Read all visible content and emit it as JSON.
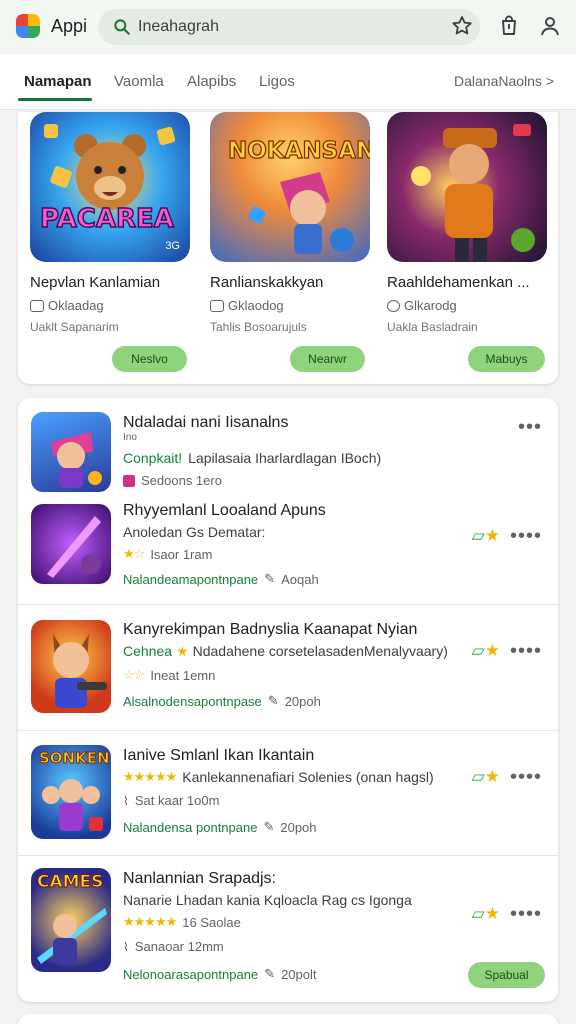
{
  "app": {
    "title": "Appi"
  },
  "search": {
    "text": "Ineahagrah"
  },
  "tabs": {
    "items": [
      "Namapan",
      "Vaomla",
      "Alapibs",
      "Ligos"
    ],
    "more": "DalanaNaolns >"
  },
  "featured": [
    {
      "art": "PACAREA",
      "badge": "3G",
      "title": "Nepvlan Kanlamian",
      "meta": "Oklaadag",
      "sub": "Uaklt Sapanarim",
      "button": "Neslvo"
    },
    {
      "art": "NOKANSAN",
      "badge": "",
      "title": "Ranlianskakkyan",
      "meta": "Gklaodog",
      "sub": "Tahlis Bosoarujuls",
      "button": "Nearwr"
    },
    {
      "art": "",
      "badge": "",
      "title": "Raahldehamenkan ...",
      "meta": "Glkarodg",
      "sub": "Uakla Basladrain",
      "button": "Mabuys"
    }
  ],
  "list": {
    "header": {
      "title": "Ndaladai nani Iisanalns",
      "subtitle": "Ino",
      "highlight": "Conpkait!",
      "desc": "Lapilasaia Iharlardlagan IBoch)",
      "meta": "Sedoons 1ero"
    },
    "rows": [
      {
        "title": "Rhyyemlanl Looaland Apuns",
        "line": "Anoledan Gs Dematar:",
        "rating_text": "Isaor 1ram",
        "green": "Nalandeamapontnpane",
        "tag": "Aoqah"
      },
      {
        "title": "Kanyrekimpan Badnyslia Kaanapat Nyian",
        "highlight": "Cehnea",
        "line": "Ndadahene corsetelasadenMenalyvaary)",
        "rating_text": "Ineat 1emn",
        "green": "Alsalnodensapontnpase",
        "tag": "20poh"
      },
      {
        "title": "Ianive Smlanl Ikan Ikantain",
        "line": "Kanlekannenafiari Solenies (onan hagsl)",
        "rating_text": "Sat kaar 1o0m",
        "green": "Nalandensa pontnpane",
        "tag": "20poh",
        "art": "SONKEN"
      },
      {
        "title": "Nanlannian Srapadjs:",
        "line": "Nanarie Lhadan kania Kqloacla Rag cs Igonga",
        "rating_text": "16 Saolae",
        "rating_text2": "Sanaoar 12mm",
        "green": "Nelonoarasapontnpane",
        "tag": "20polt",
        "art": "CAMES",
        "button": "Spabual"
      }
    ]
  },
  "colors": {
    "accent": "#137333",
    "button": "#8fd47c",
    "star": "#f4b400"
  }
}
